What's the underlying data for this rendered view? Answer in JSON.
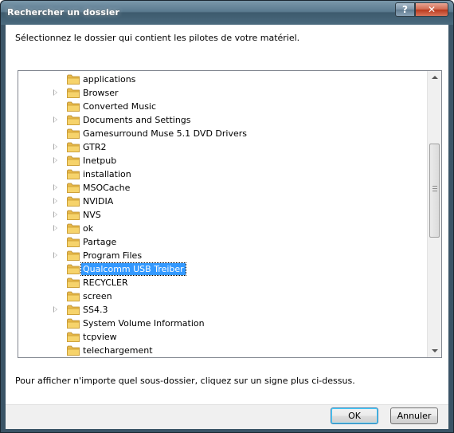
{
  "window": {
    "title": "Rechercher un dossier",
    "help_glyph": "?",
    "close_glyph": "✕"
  },
  "instruction": "Sélectionnez le dossier qui contient les pilotes de votre matériel.",
  "tree": {
    "items": [
      {
        "label": "applications",
        "expandable": false,
        "icon": "folder-icon"
      },
      {
        "label": "Browser",
        "expandable": true,
        "icon": "folder-icon"
      },
      {
        "label": "Converted Music",
        "expandable": false,
        "icon": "folder-icon"
      },
      {
        "label": "Documents and Settings",
        "expandable": true,
        "icon": "folder-icon"
      },
      {
        "label": "Gamesurround Muse 5.1 DVD Drivers",
        "expandable": false,
        "icon": "folder-icon"
      },
      {
        "label": "GTR2",
        "expandable": true,
        "icon": "folder-icon"
      },
      {
        "label": "Inetpub",
        "expandable": true,
        "icon": "folder-icon"
      },
      {
        "label": "installation",
        "expandable": false,
        "icon": "folder-icon"
      },
      {
        "label": "MSOCache",
        "expandable": true,
        "icon": "folder-icon"
      },
      {
        "label": "NVIDIA",
        "expandable": true,
        "icon": "folder-icon"
      },
      {
        "label": "NVS",
        "expandable": true,
        "icon": "folder-icon"
      },
      {
        "label": "ok",
        "expandable": true,
        "icon": "folder-icon"
      },
      {
        "label": "Partage",
        "expandable": false,
        "icon": "folder-icon"
      },
      {
        "label": "Program Files",
        "expandable": true,
        "icon": "folder-icon"
      },
      {
        "label": "Qualcomm USB Treiber",
        "expandable": false,
        "icon": "folder-icon",
        "selected": true
      },
      {
        "label": "RECYCLER",
        "expandable": false,
        "icon": "folder-icon"
      },
      {
        "label": "screen",
        "expandable": false,
        "icon": "folder-icon"
      },
      {
        "label": "SS4.3",
        "expandable": true,
        "icon": "folder-icon"
      },
      {
        "label": "System Volume Information",
        "expandable": false,
        "icon": "folder-icon"
      },
      {
        "label": "tcpview",
        "expandable": false,
        "icon": "folder-icon"
      },
      {
        "label": "telechargement",
        "expandable": false,
        "icon": "folder-icon"
      }
    ]
  },
  "hint": "Pour afficher n'importe quel sous-dossier, cliquez sur un signe plus ci-dessus.",
  "buttons": {
    "ok": "OK",
    "cancel": "Annuler"
  },
  "colors": {
    "selection": "#3399ff",
    "folder": "#f6d36b"
  }
}
